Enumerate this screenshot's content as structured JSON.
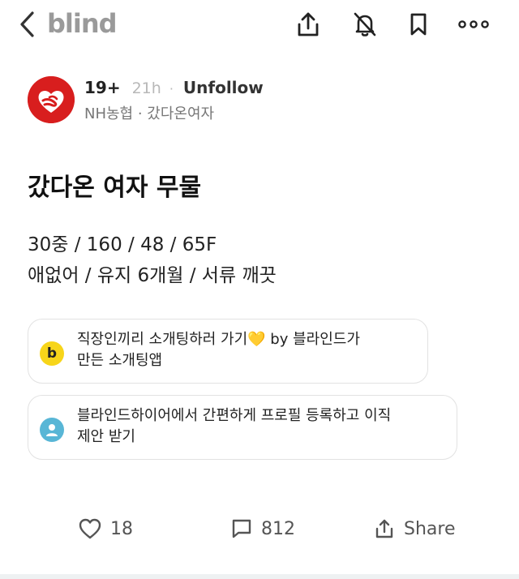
{
  "header": {
    "brand": "blind",
    "icons": [
      "chevron-left-icon",
      "share-icon",
      "bell-off-icon",
      "bookmark-icon",
      "more-icon"
    ]
  },
  "author": {
    "badge": "19+",
    "time": "21h",
    "separator": "·",
    "follow_label": "Unfollow",
    "company_channel": "NH농협 · 갔다온여자",
    "avatar_color": "#d81e1e"
  },
  "post": {
    "title": "갔다온 여자 무물",
    "line1": "30중 / 160 / 48 / 65F",
    "line2": "애없어 / 유지 6개월 / 서류 깨끗"
  },
  "promos": [
    {
      "icon": "b-logo-icon",
      "icon_letter": "b",
      "text": "직장인끼리 소개팅하러 가기💛 by 블라인드가\n만든 소개팅앱"
    },
    {
      "icon": "user-icon",
      "text": "블라인드하이어에서 간편하게 프로필 등록하고 이직\n제안 받기"
    }
  ],
  "actions": {
    "likes": "18",
    "comments": "812",
    "share_label": "Share"
  },
  "colors": {
    "brand_gray": "#9a9a9a",
    "accent_yellow": "#f7d51a",
    "accent_blue": "#58b6d6"
  }
}
